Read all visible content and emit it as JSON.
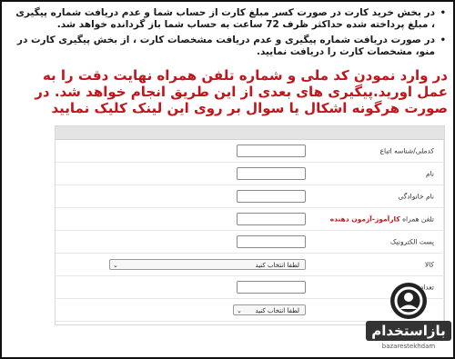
{
  "notes": [
    "در بخش خرید کارت در صورت کسر مبلغ کارت از حساب شما و عدم دریافت شماره پیگیری ، مبلغ پرداخته شده حداکثر ظرف 72 ساعت به حساب شما باز گردانده خواهد شد.",
    "در صورت دریافت شماره پیگیری و عدم دریافت مشخصات کارت ، از بخش پیگیری کارت در منو، مشخصات کارت را دریافت نمایید."
  ],
  "bullet_symbol": "•",
  "warning": "در وارد نمودن کد ملی و شماره تلفن همراه نهایت دقت را به عمل اورید.پیگیری های بعدی از این طریق انجام خواهد شد. در صورت هرگونه اشکال یا سوال بر روی این لینک کلیک نمایید",
  "form": {
    "fields": {
      "national_id": "کدملی/شناسه اتباع",
      "first_name": "نام",
      "last_name": "نام خانوادگی",
      "mobile_prefix": "تلفن همراه",
      "mobile_hint": "کارآموز-آزمون دهنده",
      "email": "پست الکترونیک",
      "product": "کالا",
      "quantity": "تعداد"
    },
    "select_placeholder": "لطفا انتخاب کنید",
    "chevron": "⌄"
  },
  "watermark": {
    "brand": "بازاستخدام",
    "sub": "bazarestekhdam"
  }
}
